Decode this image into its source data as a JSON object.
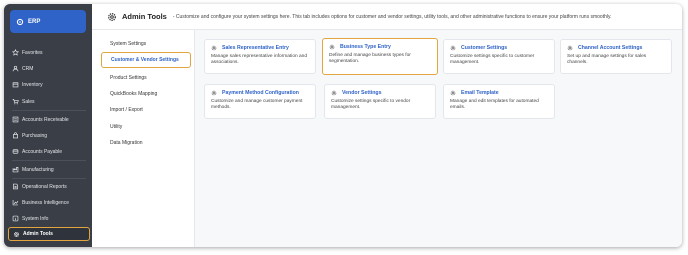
{
  "brand": {
    "label": "ERP"
  },
  "sidebar": {
    "items": [
      {
        "label": "Favorites",
        "icon": "star-icon"
      },
      {
        "label": "CRM",
        "icon": "crm-icon"
      },
      {
        "label": "Inventory",
        "icon": "box-icon"
      },
      {
        "label": "Sales",
        "icon": "cart-icon"
      },
      {
        "label": "Accounts Receivable",
        "icon": "receivable-icon"
      },
      {
        "label": "Purchasing",
        "icon": "bag-icon"
      },
      {
        "label": "Accounts Payable",
        "icon": "payable-icon"
      },
      {
        "label": "Manufacturing",
        "icon": "factory-icon"
      },
      {
        "label": "Operational Reports",
        "icon": "report-icon"
      },
      {
        "label": "Business Intelligence",
        "icon": "chart-icon"
      },
      {
        "label": "System Info",
        "icon": "info-icon"
      },
      {
        "label": "Admin Tools",
        "icon": "gear-icon"
      }
    ]
  },
  "header": {
    "title": "Admin Tools",
    "description": "- Customize and configure your system settings here. This tab includes options for customer and vendor settings, utility tools, and other administrative functions to ensure your platform runs smoothly."
  },
  "submenu": {
    "items": [
      "System Settings",
      "Customer & Vendor Settings",
      "Product Settings",
      "QuickBooks Mapping",
      "Import / Export",
      "Utility",
      "Data Migration"
    ]
  },
  "cards": [
    {
      "title": "Sales Representative Entry",
      "desc": "Manage sales representative information and associations."
    },
    {
      "title": "Business Type Entry",
      "desc": "Define and manage business types for segmentation."
    },
    {
      "title": "Customer Settings",
      "desc": "Customize settings specific to customer management."
    },
    {
      "title": "Channel Account Settings",
      "desc": "Set up and manage settings for sales channels."
    },
    {
      "title": "Payment Method Configuration",
      "desc": "Customize and manage customer payment methods."
    },
    {
      "title": "Vendor Settings",
      "desc": "Customize settings specific to vendor management."
    },
    {
      "title": "Email Template",
      "desc": "Manage and edit templates for automated emails."
    }
  ],
  "colors": {
    "accent": "#2f63c8",
    "highlight": "#e2a53f",
    "sidebar": "#3a3e47"
  }
}
